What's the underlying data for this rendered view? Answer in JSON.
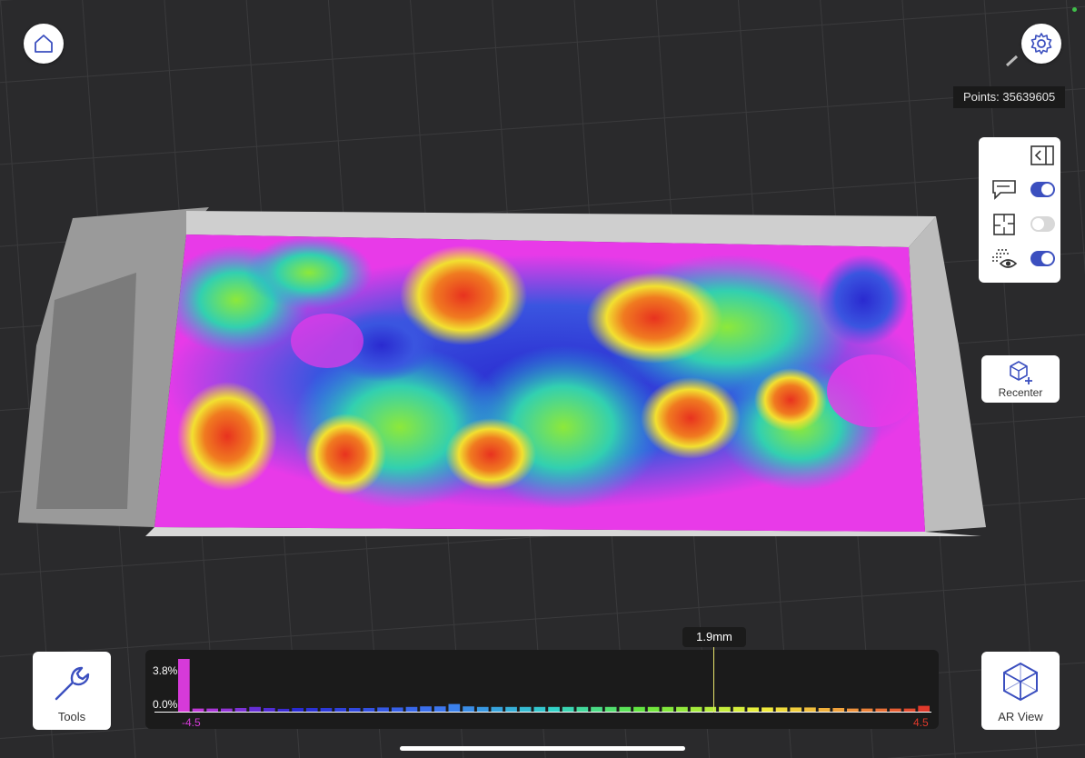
{
  "header": {
    "points_label": "Points: 35639605"
  },
  "layers": [
    {
      "name": "comments",
      "enabled": true
    },
    {
      "name": "floorplan",
      "enabled": false
    },
    {
      "name": "pointcloud-visibility",
      "enabled": true
    }
  ],
  "recenter": {
    "label": "Recenter"
  },
  "tools": {
    "label": "Tools"
  },
  "ar_view": {
    "label": "AR View"
  },
  "histogram": {
    "max_label": "3.8%",
    "min_label": "0.0%",
    "range_min": "-4.5",
    "range_max": "4.5",
    "range_min_color": "#d63ad9",
    "range_max_color": "#e0392b",
    "marker_label": "1.9mm",
    "marker_value": 1.9,
    "bars": [
      3.8,
      0.22,
      0.22,
      0.22,
      0.26,
      0.34,
      0.26,
      0.2,
      0.26,
      0.26,
      0.26,
      0.26,
      0.26,
      0.26,
      0.3,
      0.3,
      0.34,
      0.38,
      0.38,
      0.55,
      0.38,
      0.34,
      0.34,
      0.34,
      0.34,
      0.34,
      0.34,
      0.34,
      0.34,
      0.34,
      0.34,
      0.34,
      0.34,
      0.34,
      0.34,
      0.34,
      0.34,
      0.34,
      0.34,
      0.34,
      0.3,
      0.3,
      0.3,
      0.3,
      0.3,
      0.26,
      0.26,
      0.22,
      0.22,
      0.22,
      0.22,
      0.22,
      0.42
    ]
  },
  "colors": {
    "accent": "#3b4fbf",
    "background": "#2a2a2c",
    "icon": "#3b4fbf"
  }
}
